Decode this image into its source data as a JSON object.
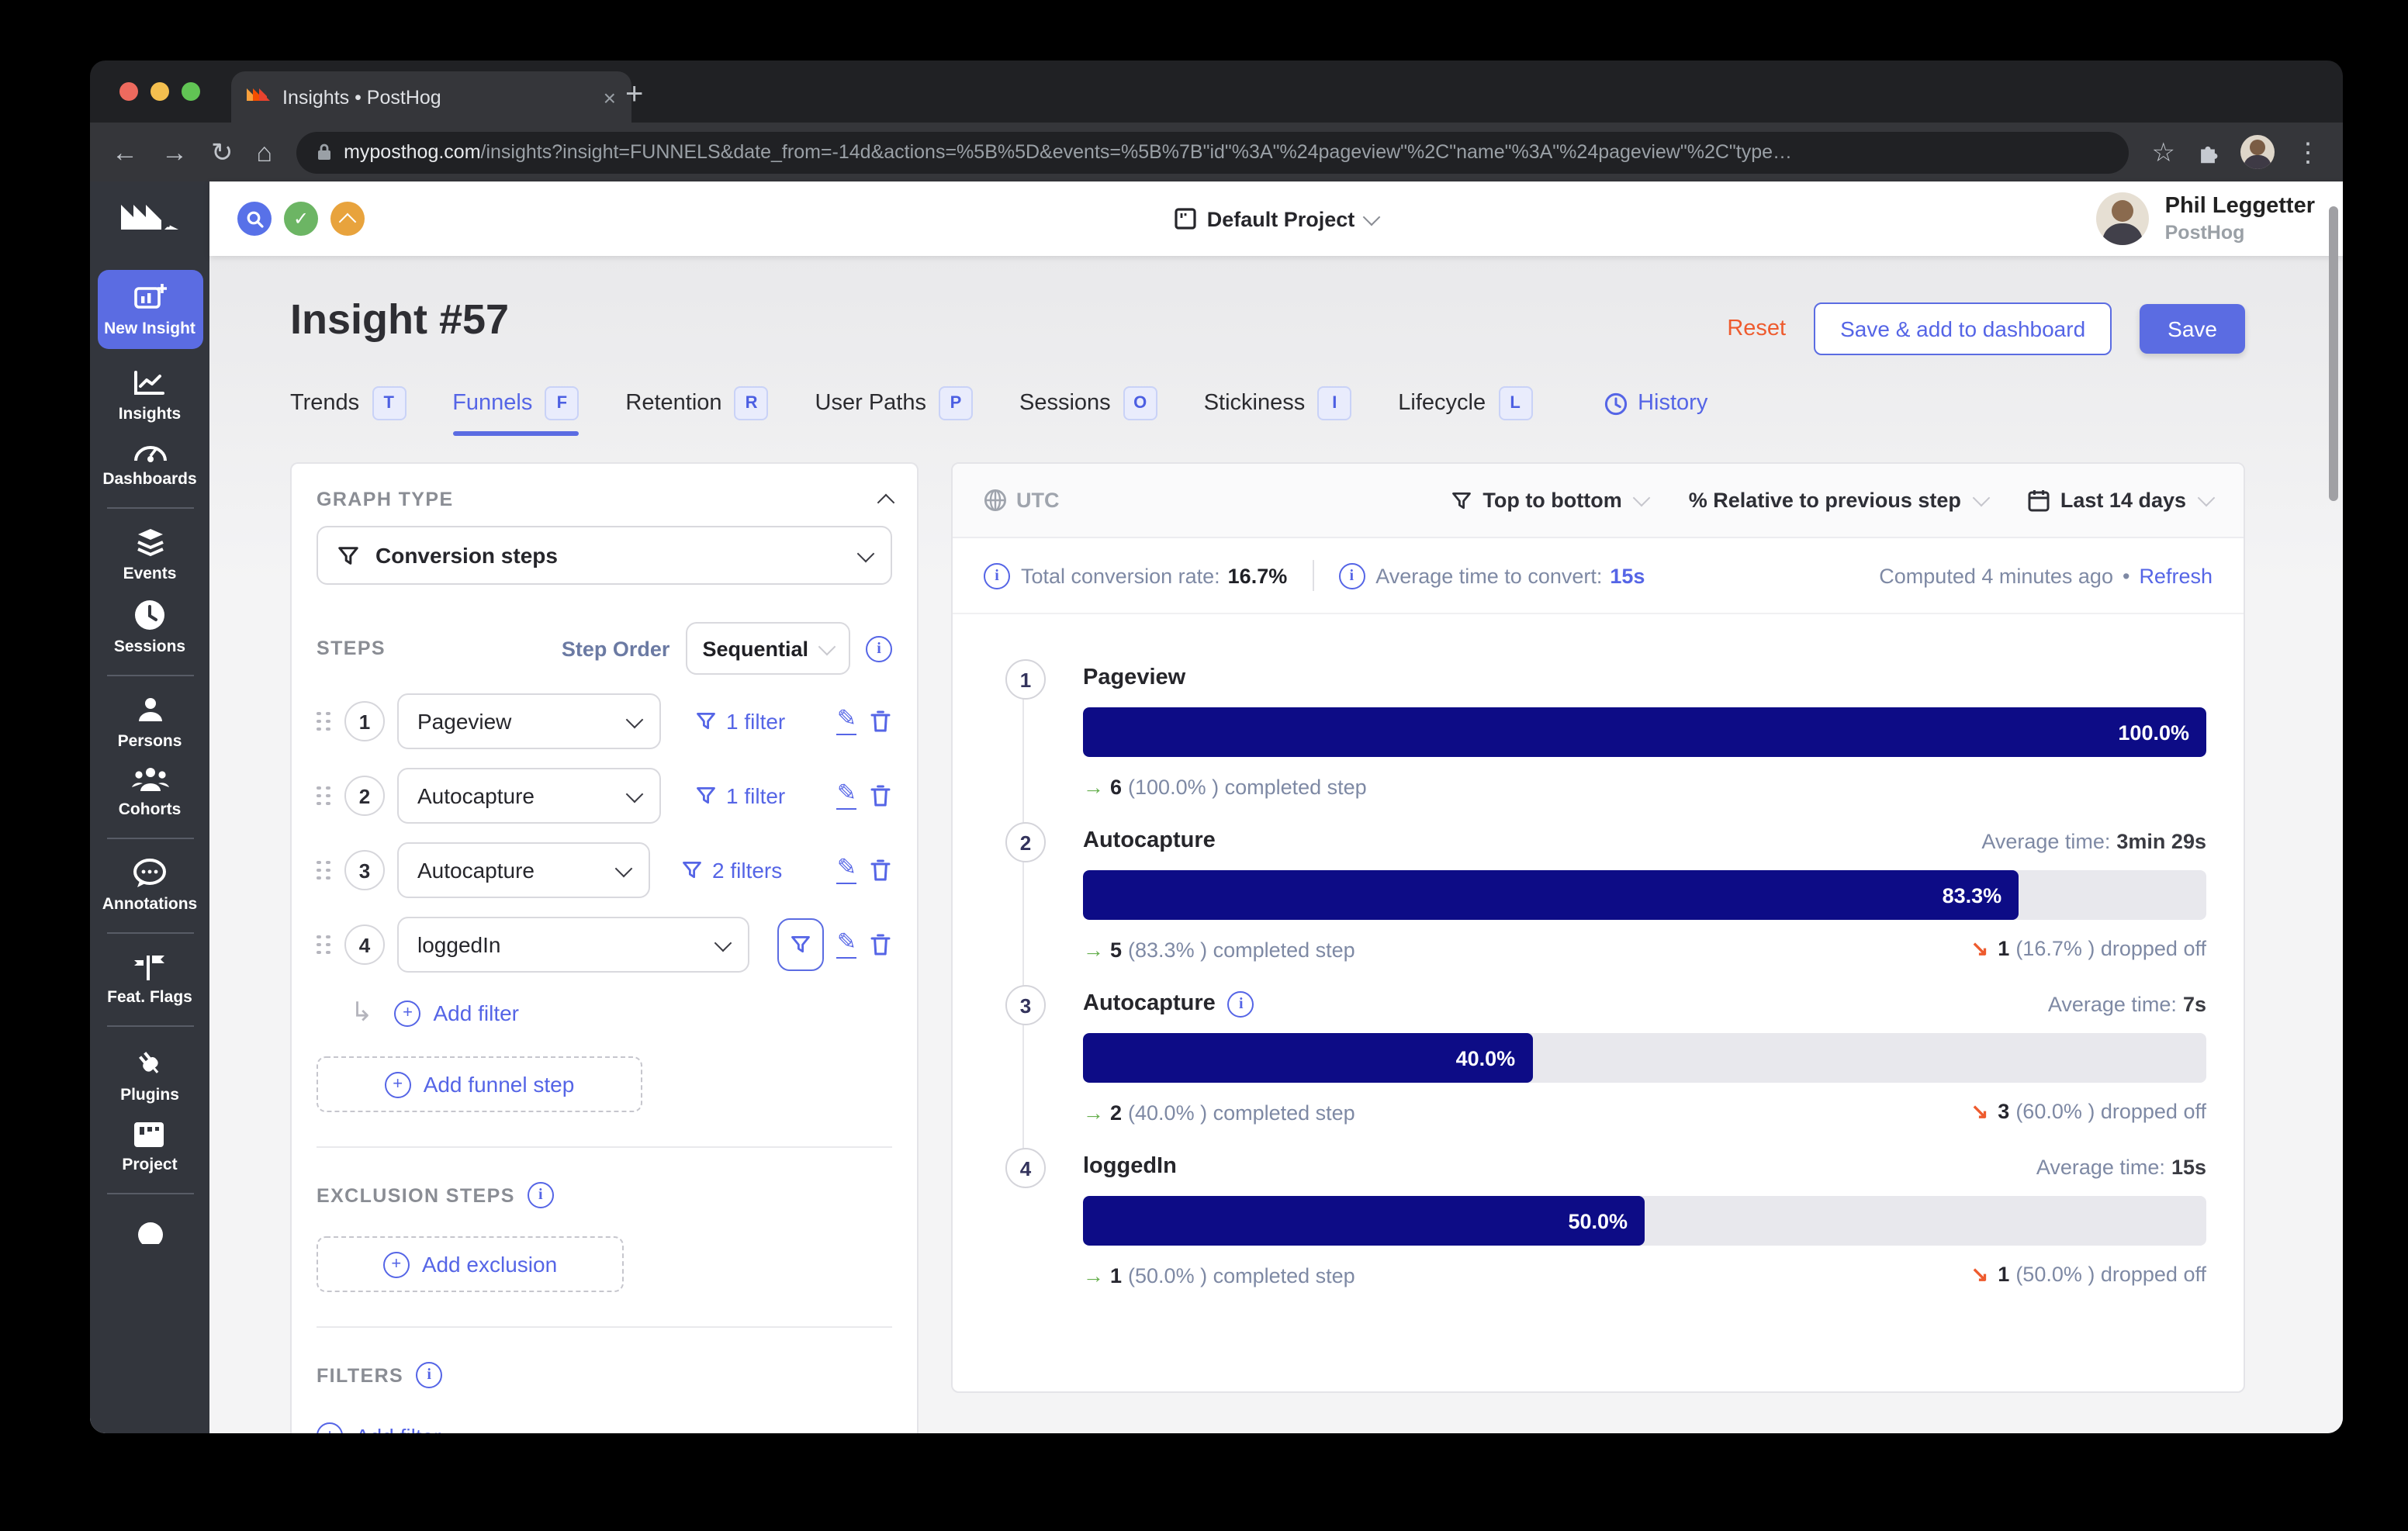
{
  "browser": {
    "tab_title": "Insights • PostHog",
    "url_domain": "myposthog.com",
    "url_path": "/insights?insight=FUNNELS&date_from=-14d&actions=%5B%5D&events=%5B%7B\"id\"%3A\"%24pageview\"%2C\"name\"%3A\"%24pageview\"%2C\"type…"
  },
  "topbar": {
    "project_label": "Default Project",
    "user_name": "Phil Leggetter",
    "user_org": "PostHog"
  },
  "sidebar": {
    "items": [
      {
        "label": "New Insight"
      },
      {
        "label": "Insights"
      },
      {
        "label": "Dashboards"
      },
      {
        "label": "Events"
      },
      {
        "label": "Sessions"
      },
      {
        "label": "Persons"
      },
      {
        "label": "Cohorts"
      },
      {
        "label": "Annotations"
      },
      {
        "label": "Feat. Flags"
      },
      {
        "label": "Plugins"
      },
      {
        "label": "Project"
      }
    ]
  },
  "header": {
    "title": "Insight #57",
    "reset_label": "Reset",
    "save_add_label": "Save & add to dashboard",
    "save_label": "Save"
  },
  "tabs": [
    {
      "label": "Trends",
      "badge": "T"
    },
    {
      "label": "Funnels",
      "badge": "F"
    },
    {
      "label": "Retention",
      "badge": "R"
    },
    {
      "label": "User Paths",
      "badge": "P"
    },
    {
      "label": "Sessions",
      "badge": "O"
    },
    {
      "label": "Stickiness",
      "badge": "I"
    },
    {
      "label": "Lifecycle",
      "badge": "L"
    }
  ],
  "history_label": "History",
  "panel": {
    "graph_type_label": "GRAPH TYPE",
    "graph_type_value": "Conversion steps",
    "steps_label": "STEPS",
    "step_order_label": "Step Order",
    "step_order_value": "Sequential",
    "steps": [
      {
        "num": "1",
        "event": "Pageview",
        "filter_label": "1 filter"
      },
      {
        "num": "2",
        "event": "Autocapture",
        "filter_label": "1 filter"
      },
      {
        "num": "3",
        "event": "Autocapture",
        "filter_label": "2 filters"
      },
      {
        "num": "4",
        "event": "loggedIn",
        "filter_label": ""
      }
    ],
    "add_filter_label": "Add filter",
    "add_funnel_step_label": "Add funnel step",
    "exclusion_label": "EXCLUSION STEPS",
    "add_exclusion_label": "Add exclusion",
    "filters_label": "FILTERS",
    "filters_add_label": "Add filter"
  },
  "results": {
    "timezone": "UTC",
    "order_label": "Top to bottom",
    "relative_label": "% Relative to previous step",
    "range_label": "Last 14 days",
    "total_rate_label": "Total conversion rate:",
    "total_rate": "16.7%",
    "avg_time_label": "Average time to convert:",
    "avg_time": "15s",
    "computed_label": "Computed 4 minutes ago",
    "dot": "•",
    "refresh_label": "Refresh"
  },
  "chart_data": {
    "type": "bar",
    "subtype": "funnel",
    "categories": [
      "Pageview",
      "Autocapture",
      "Autocapture",
      "loggedIn"
    ],
    "values": [
      100.0,
      83.3,
      40.0,
      50.0
    ],
    "series": [
      {
        "name": "completed",
        "values": [
          6,
          5,
          2,
          1
        ]
      },
      {
        "name": "dropped off",
        "values": [
          null,
          1,
          3,
          1
        ]
      }
    ],
    "avg_times": [
      null,
      "3min 29s",
      "7s",
      "15s"
    ],
    "bar_color": "#0d0c86",
    "track_color": "#e8e8ed",
    "steps": [
      {
        "num": "1",
        "label": "Pageview",
        "pct": "100.0%",
        "completed_count": "6",
        "completed_text": "(100.0% ) completed step"
      },
      {
        "num": "2",
        "label": "Autocapture",
        "pct": "83.3%",
        "avg_label": "Average time:",
        "avg_value": "3min 29s",
        "completed_count": "5",
        "completed_text": "(83.3% ) completed step",
        "dropped_count": "1",
        "dropped_text": "(16.7% ) dropped off"
      },
      {
        "num": "3",
        "label": "Autocapture",
        "pct": "40.0%",
        "avg_label": "Average time:",
        "avg_value": "7s",
        "completed_count": "2",
        "completed_text": "(40.0% ) completed step",
        "dropped_count": "3",
        "dropped_text": "(60.0% ) dropped off"
      },
      {
        "num": "4",
        "label": "loggedIn",
        "pct": "50.0%",
        "avg_label": "Average time:",
        "avg_value": "15s",
        "completed_count": "1",
        "completed_text": "(50.0% ) completed step",
        "dropped_count": "1",
        "dropped_text": "(50.0% ) dropped off"
      }
    ]
  },
  "colors": {
    "primary": "#5b6ce2",
    "link": "#5565e6",
    "bar": "#0d0c86",
    "track": "#e8e8ed",
    "orange": "#ee5b2e",
    "green": "#67b04f",
    "slate": "#7e89a4"
  }
}
